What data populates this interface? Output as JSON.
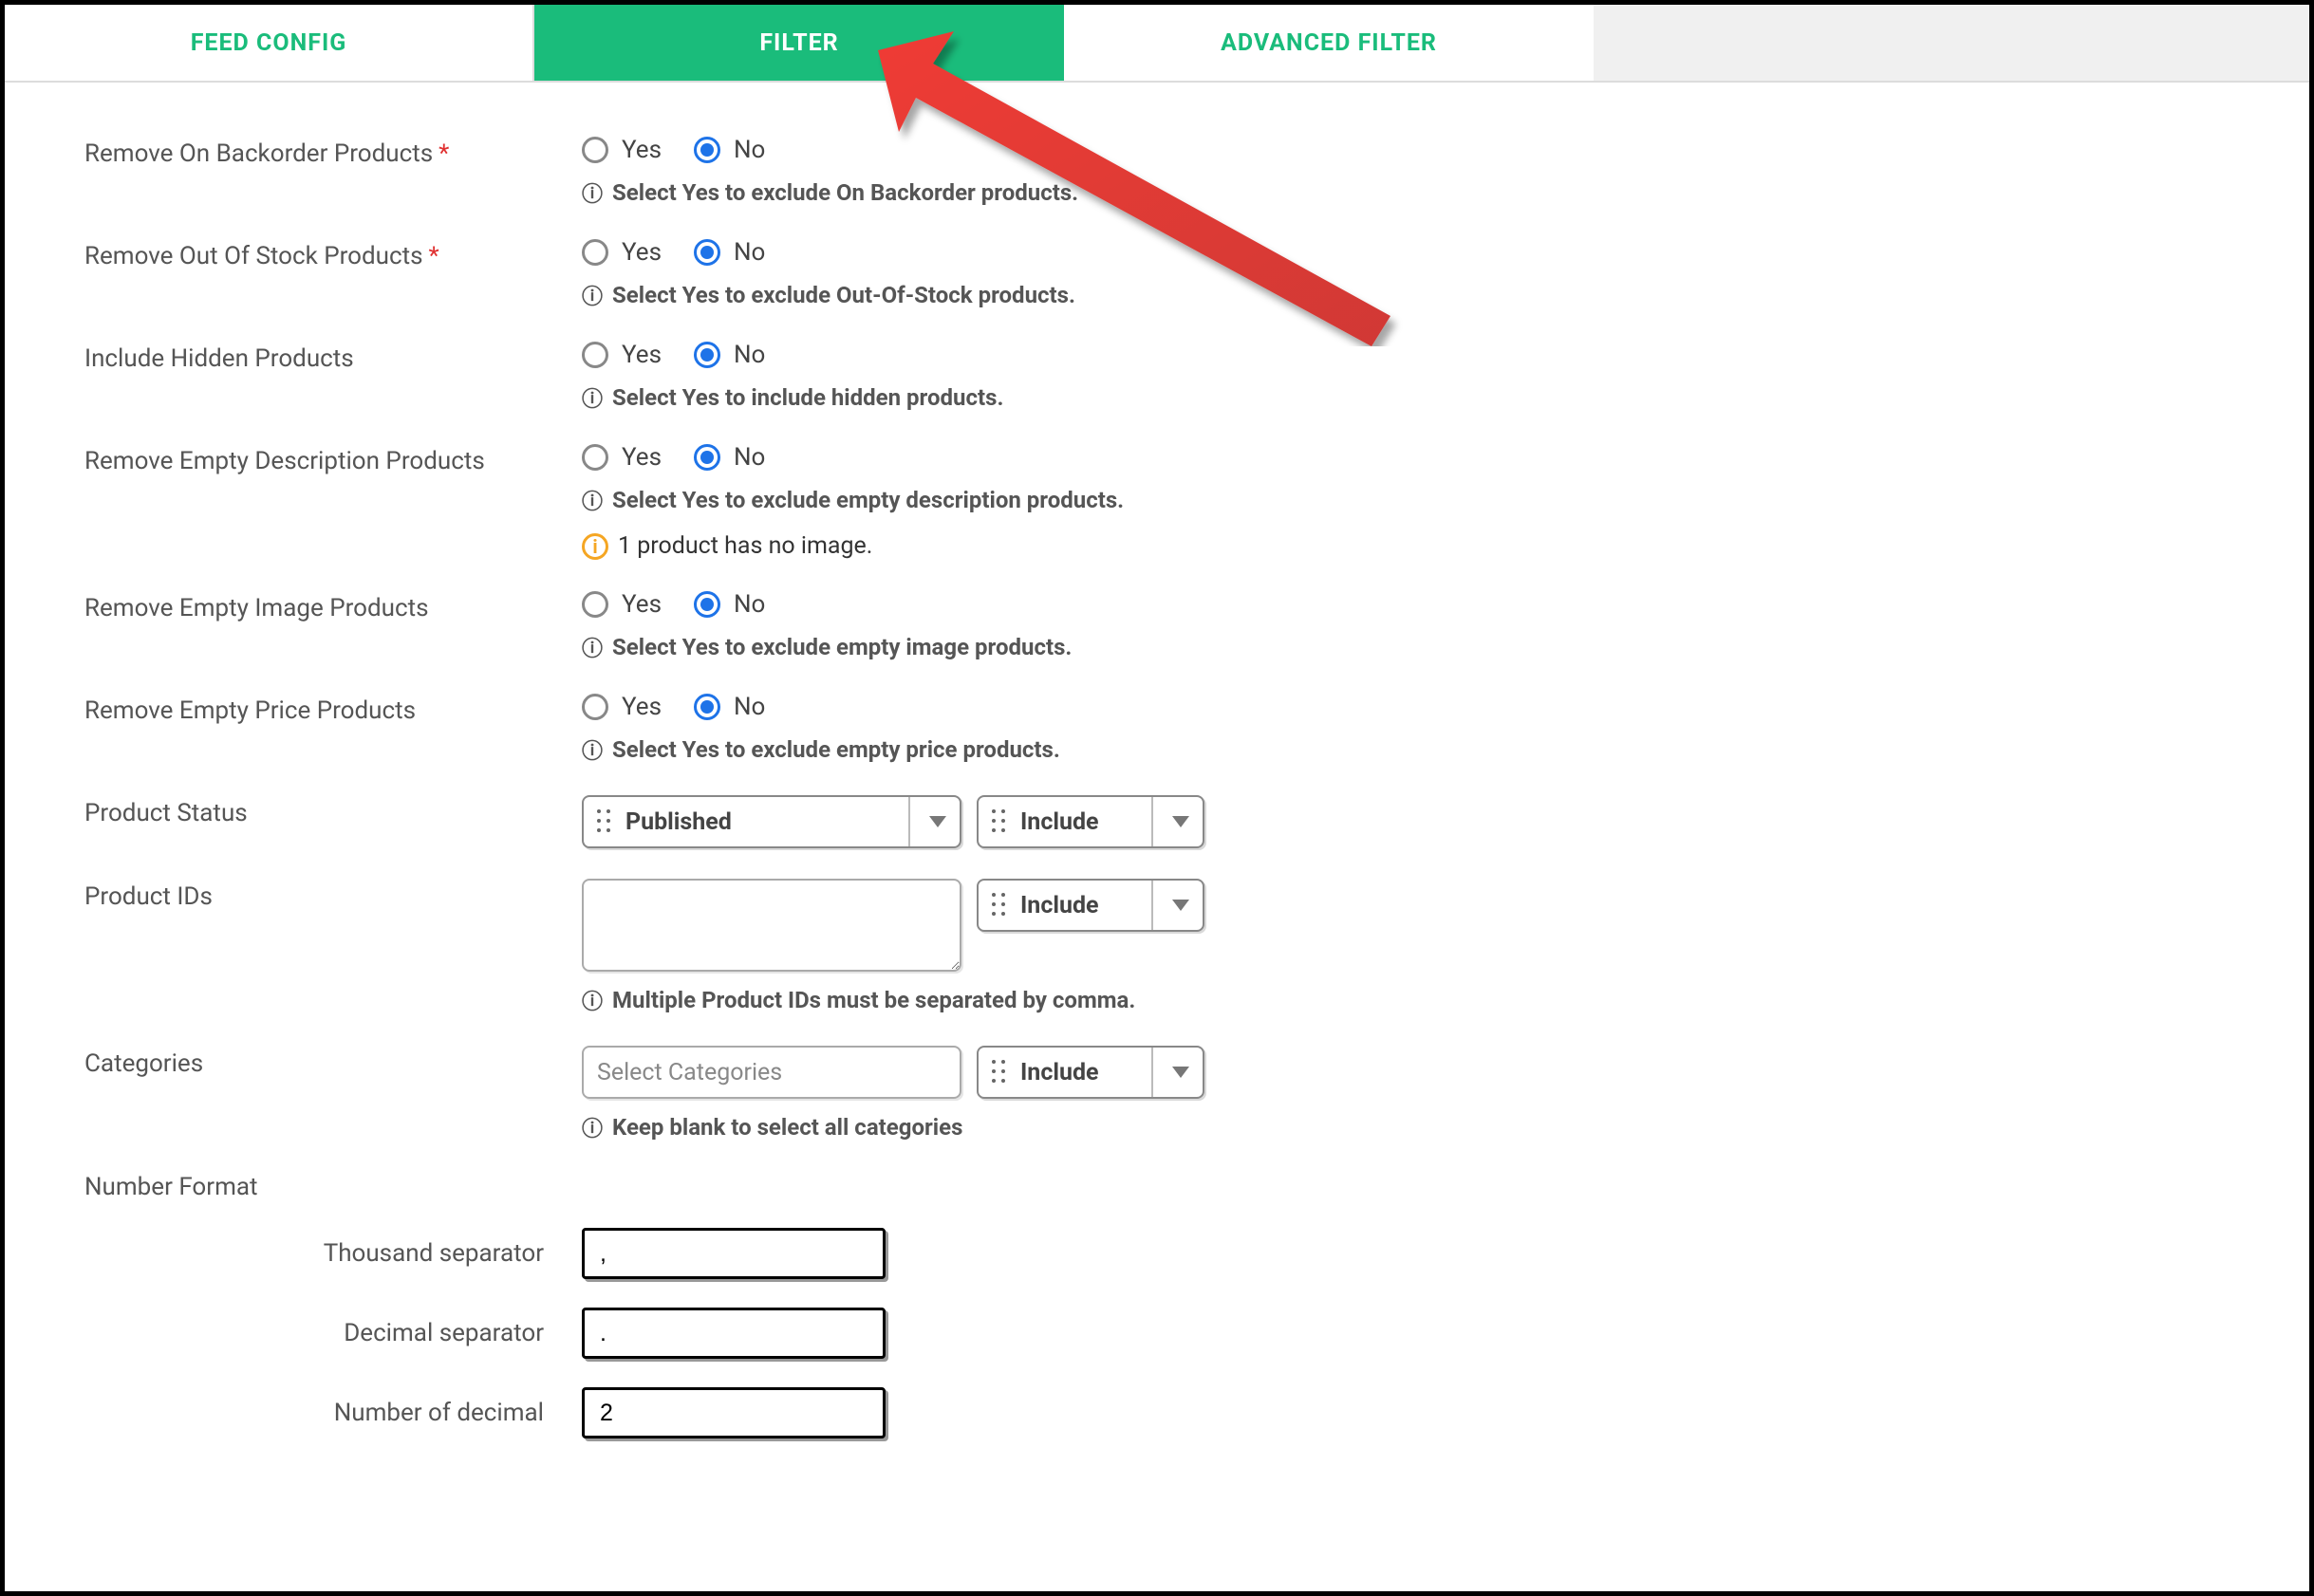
{
  "tabs": {
    "feed_config": "FEED CONFIG",
    "filter": "FILTER",
    "advanced_filter": "ADVANCED FILTER"
  },
  "options": {
    "yes": "Yes",
    "no": "No"
  },
  "rows": {
    "backorder": {
      "label": "Remove On Backorder Products",
      "hint": "Select Yes to exclude On Backorder products."
    },
    "outofstock": {
      "label": "Remove Out Of Stock Products",
      "hint": "Select Yes to exclude Out-Of-Stock products."
    },
    "hidden": {
      "label": "Include Hidden Products",
      "hint": "Select Yes to include hidden products."
    },
    "empty_desc": {
      "label": "Remove Empty Description Products",
      "hint": "Select Yes to exclude empty description products.",
      "warn": "1 product has no image."
    },
    "empty_img": {
      "label": "Remove Empty Image Products",
      "hint": "Select Yes to exclude empty image products."
    },
    "empty_price": {
      "label": "Remove Empty Price Products",
      "hint": "Select Yes to exclude empty price products."
    },
    "status": {
      "label": "Product Status",
      "value": "Published",
      "mode": "Include"
    },
    "ids": {
      "label": "Product IDs",
      "value": "",
      "mode": "Include",
      "hint": "Multiple Product IDs must be separated by comma."
    },
    "categories": {
      "label": "Categories",
      "placeholder": "Select Categories",
      "mode": "Include",
      "hint": "Keep blank to select all categories"
    }
  },
  "number_format": {
    "heading": "Number Format",
    "thousand_label": "Thousand separator",
    "thousand_value": ",",
    "decimal_label": "Decimal separator",
    "decimal_value": ".",
    "count_label": "Number of decimal",
    "count_value": "2"
  }
}
